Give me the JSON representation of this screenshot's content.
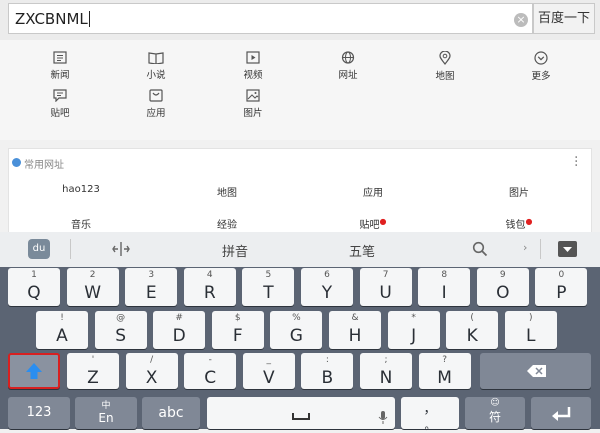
{
  "search": {
    "query": "ZXCBNML",
    "button_label": "百度一下"
  },
  "quick_nav": [
    {
      "label": "新闻",
      "icon": "news-icon"
    },
    {
      "label": "小说",
      "icon": "book-icon"
    },
    {
      "label": "视频",
      "icon": "video-icon"
    },
    {
      "label": "网址",
      "icon": "globe-icon"
    },
    {
      "label": "地图",
      "icon": "map-pin-icon"
    },
    {
      "label": "更多",
      "icon": "chevron-down-icon"
    },
    {
      "label": "贴吧",
      "icon": "chat-icon"
    },
    {
      "label": "应用",
      "icon": "app-icon"
    },
    {
      "label": "图片",
      "icon": "image-icon"
    }
  ],
  "common_sites": {
    "title": "常用网址",
    "links": [
      "hao123",
      "地图",
      "应用",
      "图片",
      "音乐",
      "经验",
      "贴吧",
      "钱包"
    ]
  },
  "keyboard": {
    "toolbar": {
      "mode_pinyin": "拼音",
      "mode_wubi": "五笔"
    },
    "row1": [
      {
        "sub": "1",
        "main": "Q"
      },
      {
        "sub": "2",
        "main": "W"
      },
      {
        "sub": "3",
        "main": "E"
      },
      {
        "sub": "4",
        "main": "R"
      },
      {
        "sub": "5",
        "main": "T"
      },
      {
        "sub": "6",
        "main": "Y"
      },
      {
        "sub": "7",
        "main": "U"
      },
      {
        "sub": "8",
        "main": "I"
      },
      {
        "sub": "9",
        "main": "O"
      },
      {
        "sub": "0",
        "main": "P"
      }
    ],
    "row2": [
      {
        "sub": "!",
        "main": "A"
      },
      {
        "sub": "@",
        "main": "S"
      },
      {
        "sub": "#",
        "main": "D"
      },
      {
        "sub": "$",
        "main": "F"
      },
      {
        "sub": "%",
        "main": "G"
      },
      {
        "sub": "&",
        "main": "H"
      },
      {
        "sub": "*",
        "main": "J"
      },
      {
        "sub": "(",
        "main": "K"
      },
      {
        "sub": ")",
        "main": "L"
      }
    ],
    "row3": [
      {
        "sub": "'",
        "main": "Z"
      },
      {
        "sub": "/",
        "main": "X"
      },
      {
        "sub": "-",
        "main": "C"
      },
      {
        "sub": "_",
        "main": "V"
      },
      {
        "sub": ":",
        "main": "B"
      },
      {
        "sub": ";",
        "main": "N"
      },
      {
        "sub": "?",
        "main": "M"
      }
    ],
    "bottom": {
      "num_label": "123",
      "lang_sub": "中",
      "lang_main": "En",
      "abc_label": "abc",
      "punct_main": "，",
      "punct_sub": "。",
      "symbol_sub": "☺",
      "symbol_main": "符"
    }
  }
}
